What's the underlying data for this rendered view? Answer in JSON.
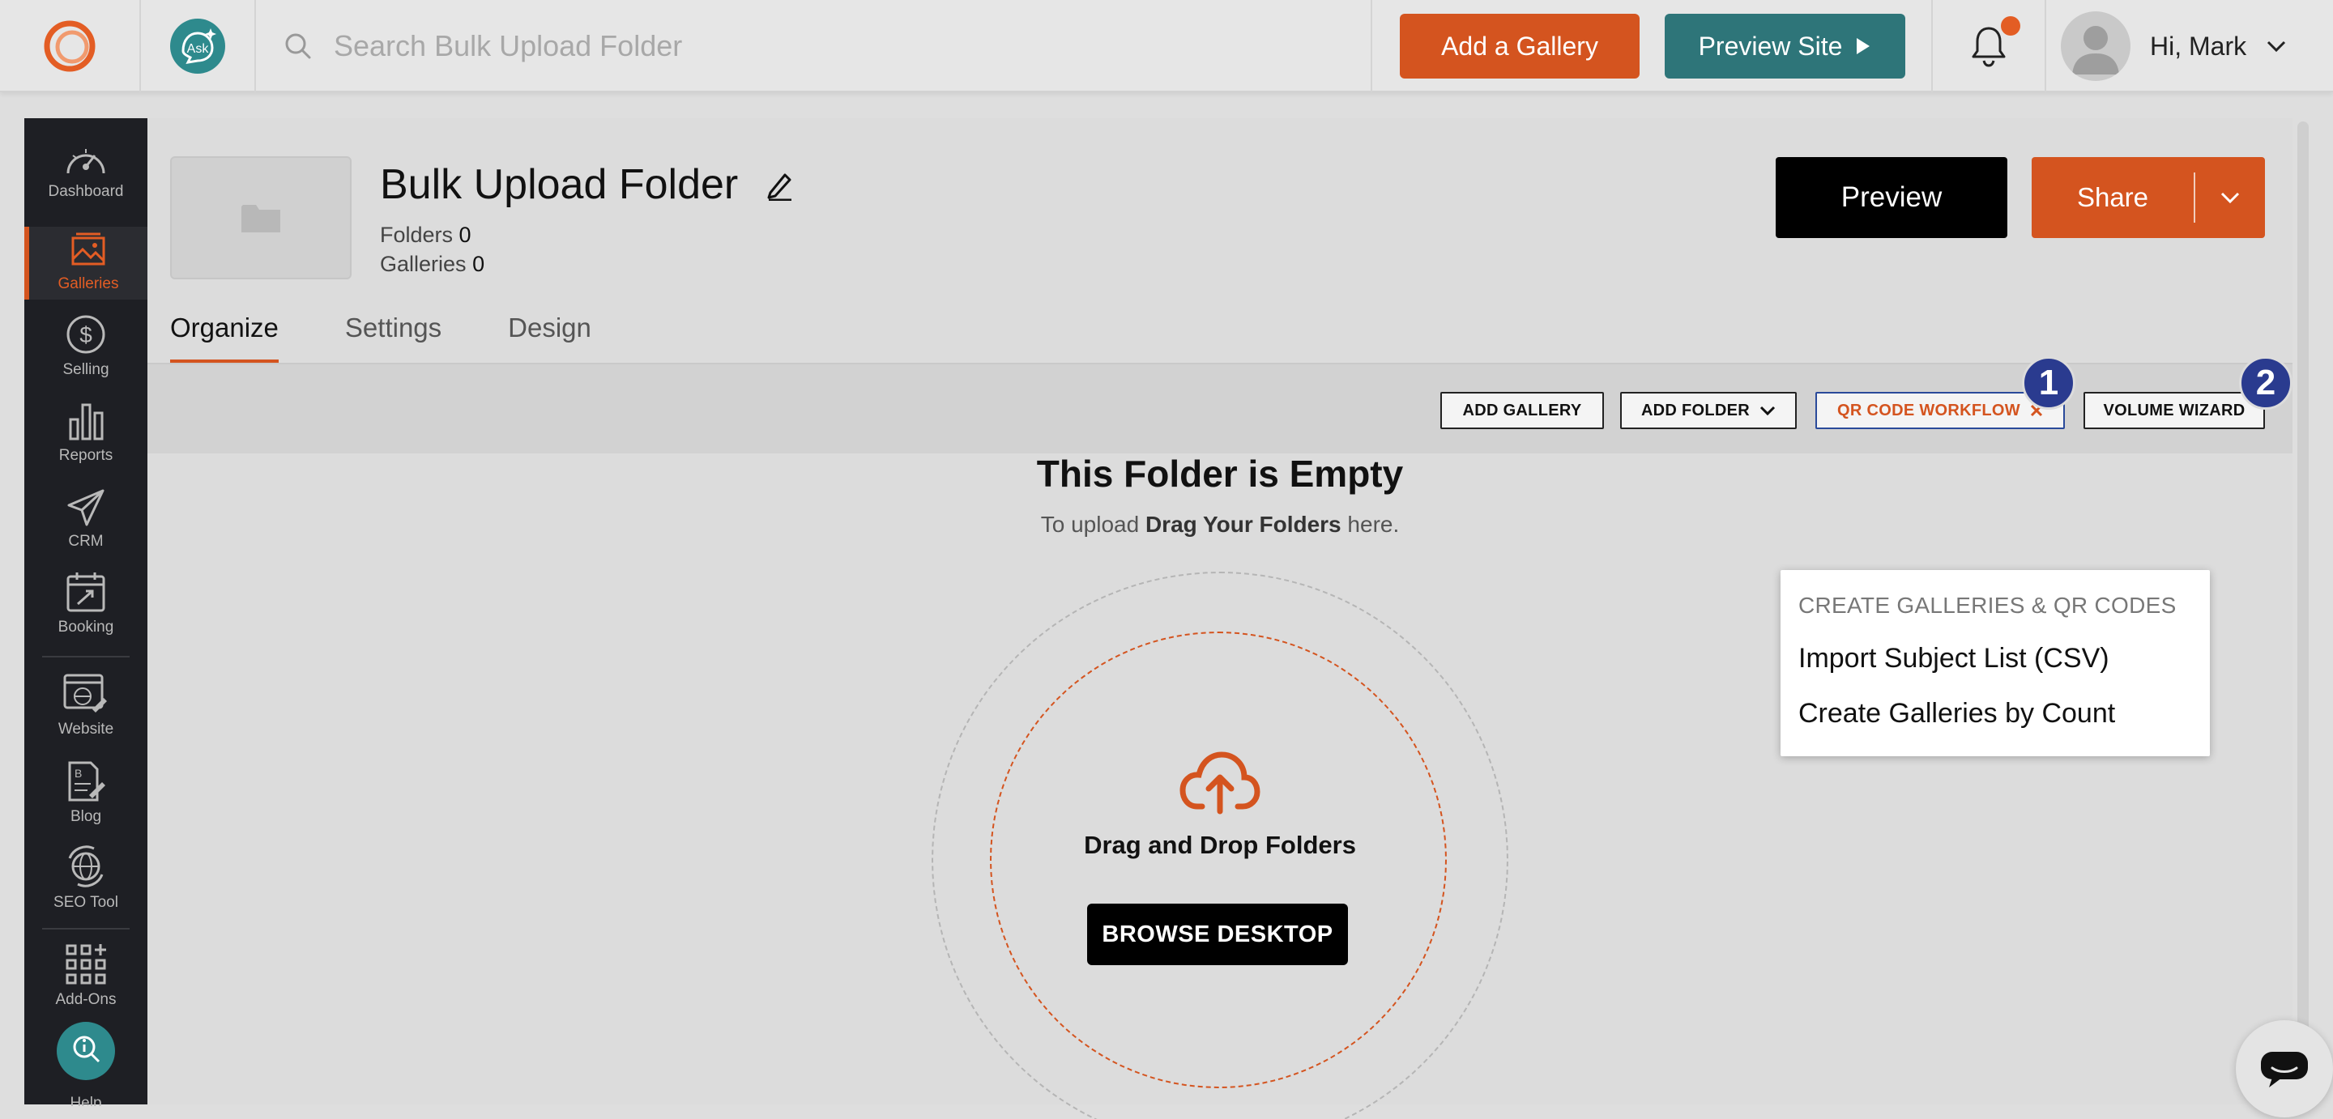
{
  "topbar": {
    "search_placeholder": "Search Bulk Upload Folder",
    "add_gallery": "Add a Gallery",
    "preview_site": "Preview Site",
    "greeting": "Hi, Mark",
    "ask_icon_text": "Ask"
  },
  "sidebar": {
    "items": [
      {
        "label": "Dashboard",
        "icon": "gauge-icon"
      },
      {
        "label": "Galleries",
        "icon": "image-icon",
        "active": true
      },
      {
        "label": "Selling",
        "icon": "dollar-icon"
      },
      {
        "label": "Reports",
        "icon": "bar-chart-icon"
      },
      {
        "label": "CRM",
        "icon": "send-icon"
      },
      {
        "label": "Booking",
        "icon": "calendar-icon"
      },
      {
        "label": "Website",
        "icon": "website-icon"
      },
      {
        "label": "Blog",
        "icon": "blog-icon"
      },
      {
        "label": "SEO Tool",
        "icon": "globe-icon"
      },
      {
        "label": "Add-Ons",
        "icon": "grid-icon"
      },
      {
        "label": "Help",
        "icon": "help-icon"
      }
    ]
  },
  "folder": {
    "title": "Bulk Upload Folder",
    "folders_label": "Folders",
    "folders_count": "0",
    "galleries_label": "Galleries",
    "galleries_count": "0"
  },
  "actions": {
    "preview": "Preview",
    "share": "Share"
  },
  "tabs": [
    {
      "label": "Organize",
      "active": true
    },
    {
      "label": "Settings"
    },
    {
      "label": "Design"
    }
  ],
  "toolbar": {
    "add_gallery": "ADD GALLERY",
    "add_folder": "ADD FOLDER",
    "qr_workflow": "QR CODE WORKFLOW",
    "volume_wizard": "VOLUME WIZARD",
    "badge_1": "1",
    "badge_2": "2"
  },
  "dropdown": {
    "heading": "CREATE GALLERIES & QR CODES",
    "items": [
      "Import Subject List (CSV)",
      "Create Galleries by Count"
    ]
  },
  "empty": {
    "title": "This Folder is Empty",
    "sub_prefix": "To upload ",
    "sub_bold": "Drag Your Folders",
    "sub_suffix": " here.",
    "drop_label": "Drag and Drop Folders",
    "browse": "BROWSE DESKTOP"
  },
  "colors": {
    "brand_orange": "#d4541f",
    "brand_teal": "#2e7579",
    "sidebar_bg": "#1e1f24",
    "badge_blue": "#2a3b8f"
  }
}
